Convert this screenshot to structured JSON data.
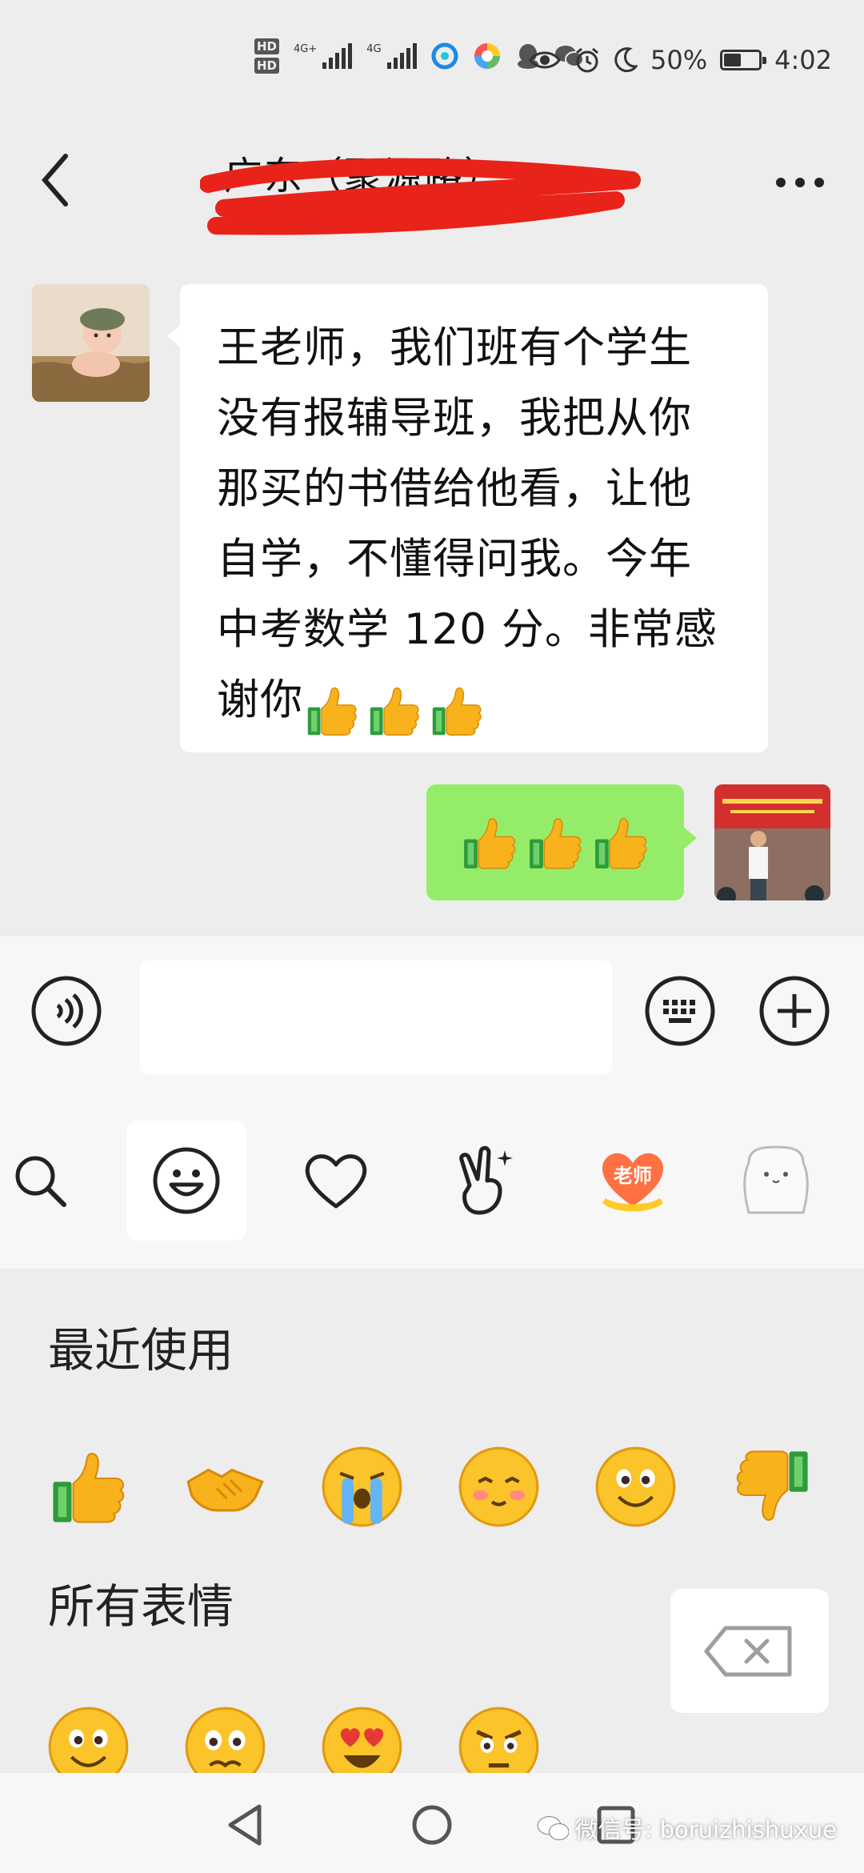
{
  "status_bar": {
    "hd1": "HD",
    "hd2": "HD",
    "net1": "4G+",
    "net2": "4G",
    "battery_text": "50%",
    "battery_level": 0.5,
    "time": "4:02",
    "icons": [
      "edge-icon",
      "colorful-app-icon",
      "qq-icon",
      "wechat-icon",
      "eye-icon",
      "alarm-icon",
      "moon-icon"
    ]
  },
  "header": {
    "title": "广东（聚源路）",
    "back_icon": "chevron-left-icon",
    "more_icon": "more-dots-icon"
  },
  "messages": [
    {
      "side": "left",
      "text": "王老师，我们班有个学生\n没有报辅导班，我把从你\n那买的书借给他看，让他\n自学，不懂得问我。今年\n中考数学 120 分。非常感\n谢你",
      "emoji": [
        "thumbs-up",
        "thumbs-up",
        "thumbs-up"
      ]
    },
    {
      "side": "right",
      "emoji": [
        "thumbs-up",
        "thumbs-up",
        "thumbs-up"
      ]
    }
  ],
  "input": {
    "value": "",
    "voice_icon": "voice-icon",
    "keyboard_icon": "keyboard-icon",
    "plus_icon": "plus-icon"
  },
  "emoji_tabs": [
    "search-icon",
    "smiley-icon",
    "heart-icon",
    "victory-hand-icon",
    "teacher-heart-sticker",
    "bear-sticker"
  ],
  "sticker_text": "老师",
  "emoji_panel": {
    "recent_title": "最近使用",
    "recent": [
      "thumbs-up",
      "handshake",
      "crying",
      "shy",
      "smile",
      "thumbs-down"
    ],
    "all_title": "所有表情",
    "all": [
      "smile",
      "worried",
      "heart-eyes",
      "angry"
    ]
  },
  "nav": {
    "back": "back-triangle-icon",
    "home": "home-circle-icon",
    "recents": "recents-square-icon"
  },
  "watermark": "微信号: boruizhishuxue",
  "colors": {
    "background": "#ededed",
    "bubble_left": "#ffffff",
    "bubble_right": "#95ec69",
    "scribble": "#e8231a"
  }
}
